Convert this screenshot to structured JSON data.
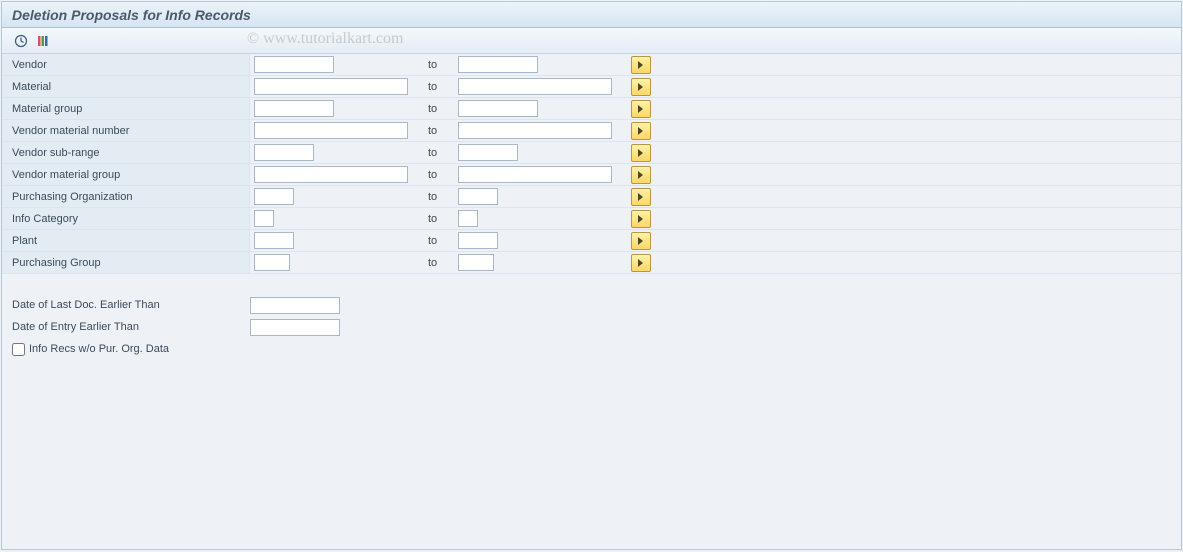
{
  "title": "Deletion Proposals for Info Records",
  "watermark": "© www.tutorialkart.com",
  "toLabel": "to",
  "selectionRows": [
    {
      "id": "vendor",
      "label": "Vendor",
      "fromW": 80,
      "toW": 80
    },
    {
      "id": "material",
      "label": "Material",
      "fromW": 154,
      "toW": 154
    },
    {
      "id": "material-group",
      "label": "Material group",
      "fromW": 80,
      "toW": 80
    },
    {
      "id": "vendor-material-number",
      "label": "Vendor material number",
      "fromW": 154,
      "toW": 154
    },
    {
      "id": "vendor-sub-range",
      "label": "Vendor sub-range",
      "fromW": 60,
      "toW": 60
    },
    {
      "id": "vendor-material-group",
      "label": "Vendor material group",
      "fromW": 154,
      "toW": 154
    },
    {
      "id": "purchasing-organization",
      "label": "Purchasing Organization",
      "fromW": 40,
      "toW": 40
    },
    {
      "id": "info-category",
      "label": "Info Category",
      "fromW": 20,
      "toW": 20
    },
    {
      "id": "plant",
      "label": "Plant",
      "fromW": 40,
      "toW": 40
    },
    {
      "id": "purchasing-group",
      "label": "Purchasing Group",
      "fromW": 36,
      "toW": 36
    }
  ],
  "extraRows": [
    {
      "id": "date-last-doc",
      "label": "Date of Last Doc. Earlier Than",
      "w": 90
    },
    {
      "id": "date-entry",
      "label": "Date of Entry Earlier Than",
      "w": 90
    }
  ],
  "checkbox": {
    "id": "info-recs-wo",
    "label": "Info Recs w/o Pur. Org. Data"
  }
}
